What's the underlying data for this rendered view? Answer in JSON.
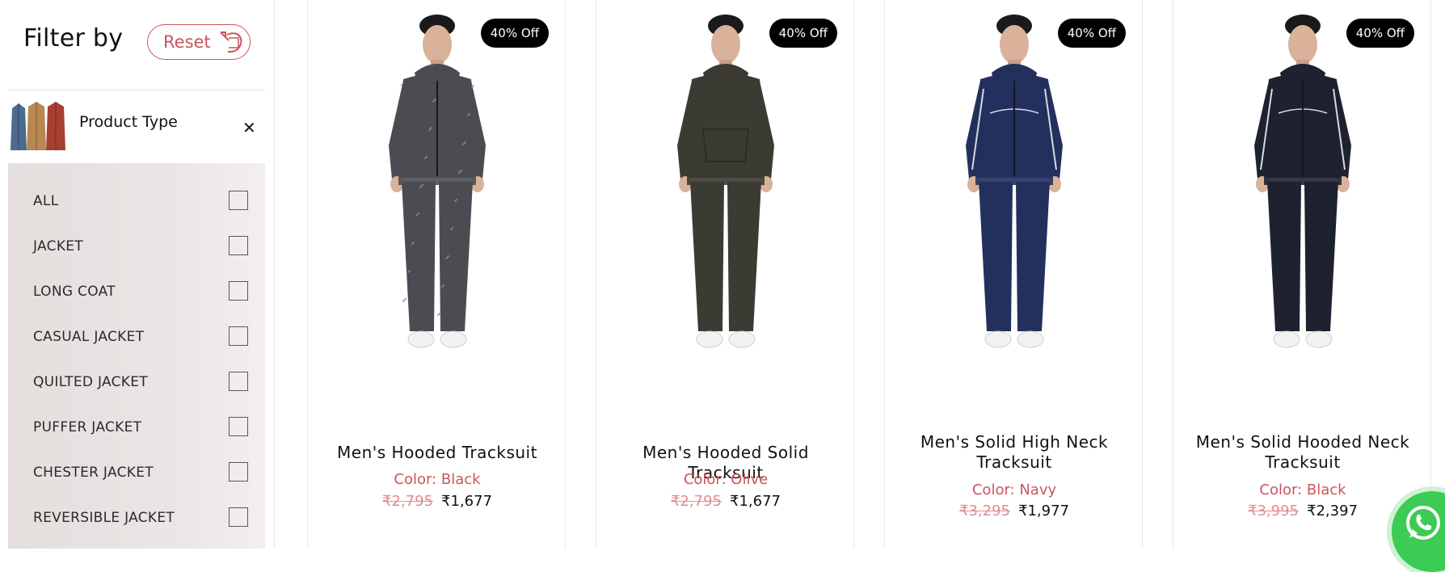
{
  "sidebar": {
    "title": "Filter by",
    "reset_label": "Reset",
    "product_type_label": "Product Type",
    "close_glyph": "✕",
    "options": [
      {
        "label": "ALL"
      },
      {
        "label": "JACKET"
      },
      {
        "label": "LONG COAT"
      },
      {
        "label": "CASUAL JACKET"
      },
      {
        "label": "QUILTED JACKET"
      },
      {
        "label": "PUFFER JACKET"
      },
      {
        "label": "CHESTER JACKET"
      },
      {
        "label": "REVERSIBLE JACKET"
      }
    ]
  },
  "products": [
    {
      "badge": "40% Off",
      "name": "Men's Hooded Tracksuit",
      "color": "Color: Black",
      "old_price": "₹2,795",
      "price": "₹1,677",
      "suit_color": "#4a4c52",
      "hoodie_texture": "heather"
    },
    {
      "badge": "40% Off",
      "name": "Men's Hooded Solid Tracksuit",
      "color": "Color: Olive",
      "old_price": "₹2,795",
      "price": "₹1,677",
      "suit_color": "#3b3b33",
      "hoodie_texture": "solid"
    },
    {
      "badge": "40% Off",
      "name": "Men's Solid High Neck Tracksuit",
      "color": "Color: Navy",
      "old_price": "₹3,295",
      "price": "₹1,977",
      "suit_color": "#23305e",
      "hoodie_texture": "piping"
    },
    {
      "badge": "40% Off",
      "name": "Men's Solid Hooded Neck Tracksuit",
      "color": "Color: Black",
      "old_price": "₹3,995",
      "price": "₹2,397",
      "suit_color": "#1e2230",
      "hoodie_texture": "piping"
    }
  ],
  "colors": {
    "accent": "#c9555c",
    "strike_price": "#e08c90",
    "badge_bg": "#000000",
    "whatsapp": "#3ccb54"
  },
  "icons": {
    "reset": "reset-arrow-icon",
    "close": "close-icon",
    "whatsapp": "whatsapp-icon"
  }
}
